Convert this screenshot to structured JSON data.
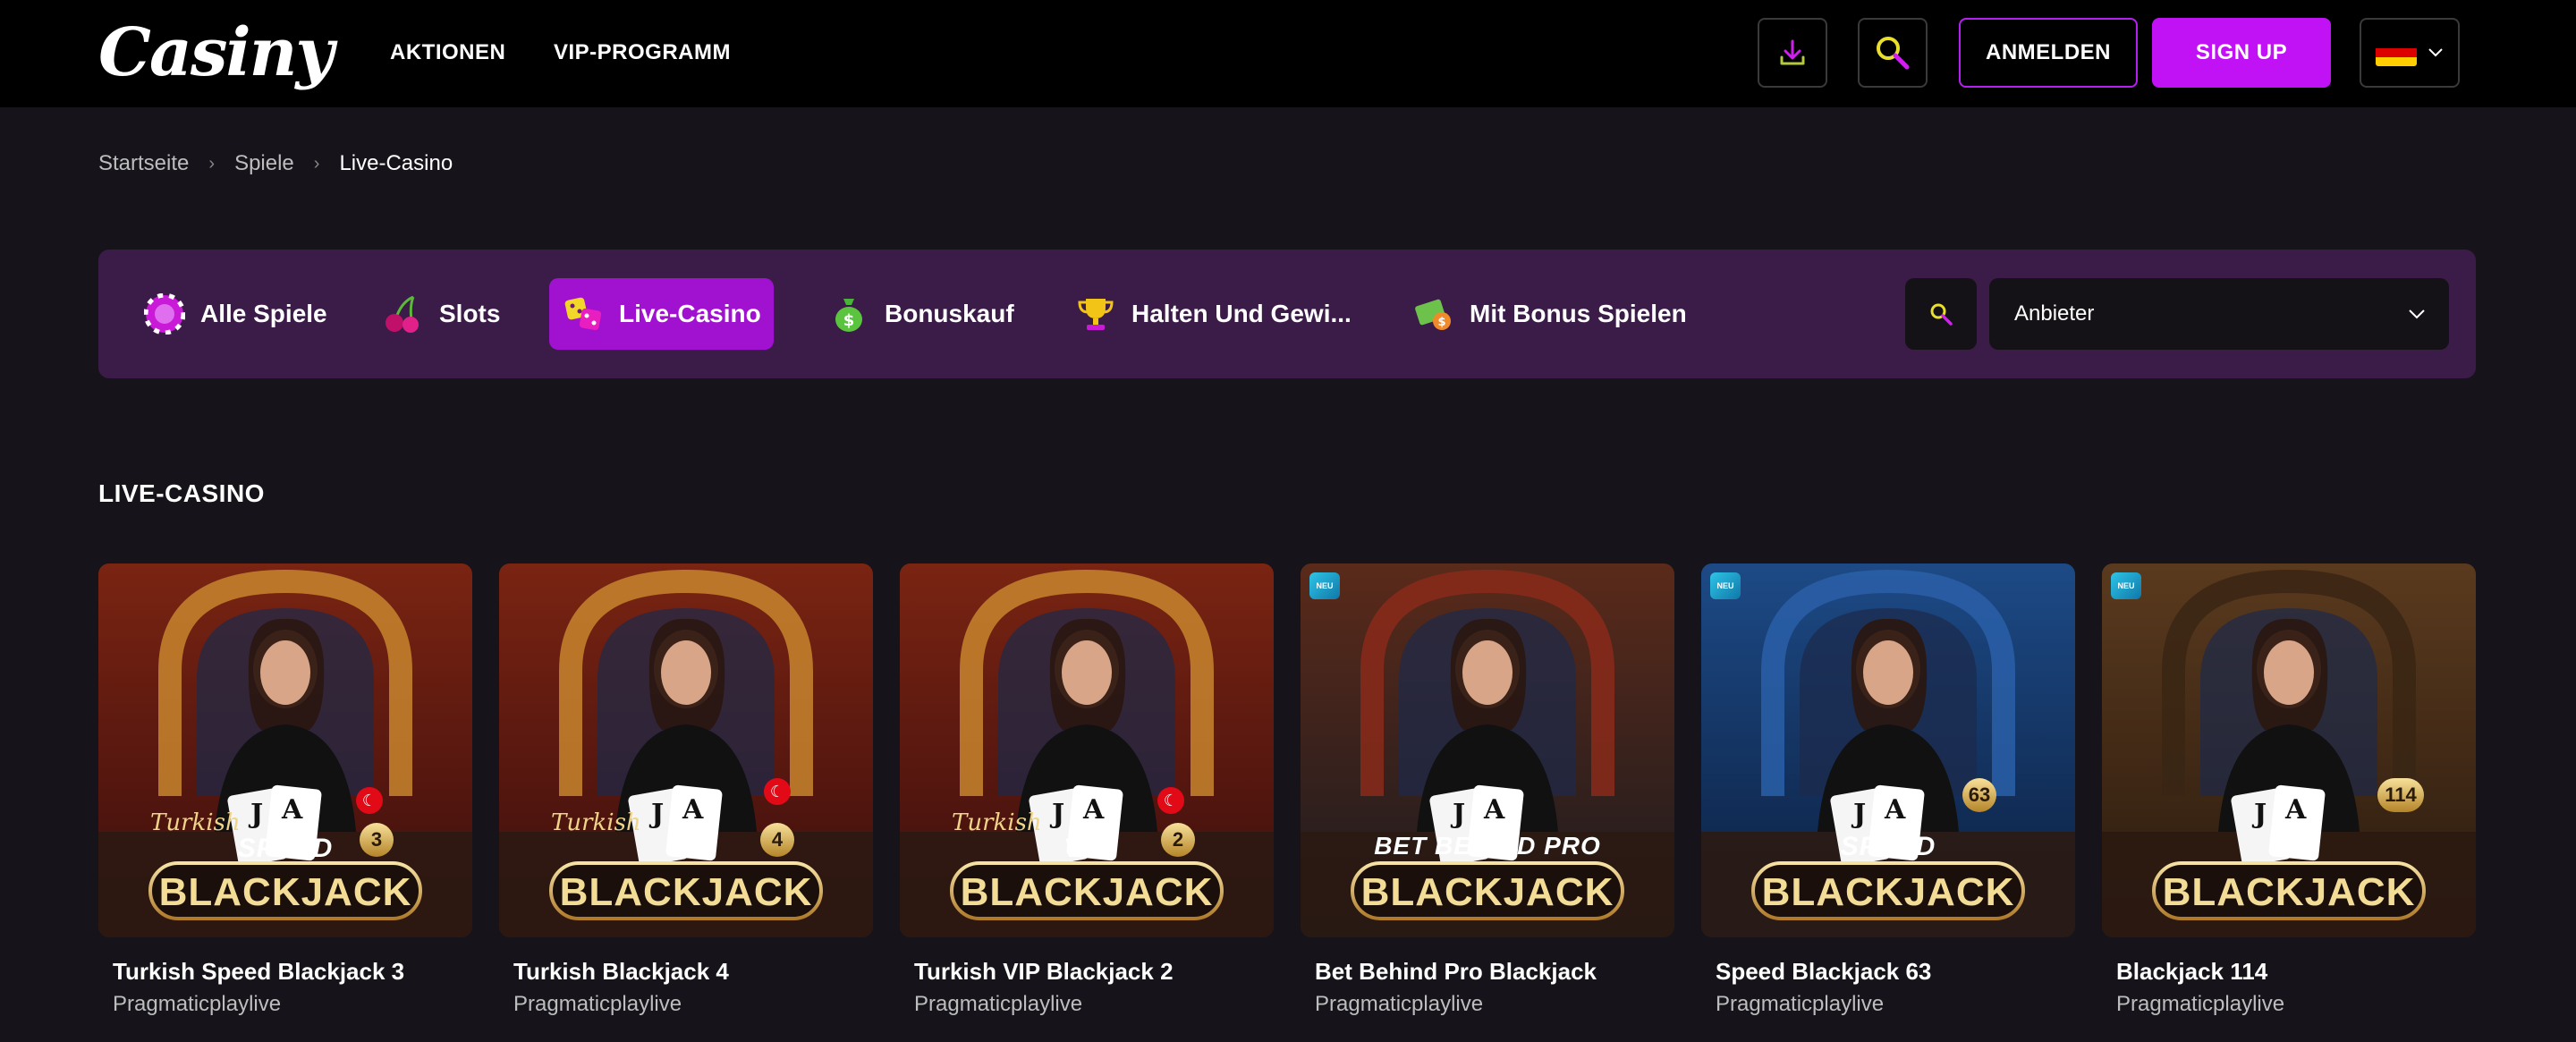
{
  "header": {
    "logo": "Casiny",
    "nav": [
      {
        "label": "AKTIONEN"
      },
      {
        "label": "VIP-PROGRAMM"
      }
    ],
    "login_label": "ANMELDEN",
    "signup_label": "SIGN UP",
    "language_flag": "de-flag-icon"
  },
  "breadcrumb": [
    "Startseite",
    "Spiele",
    "Live-Casino"
  ],
  "categories": [
    {
      "label": "Alle Spiele",
      "icon": "chip-icon",
      "active": false
    },
    {
      "label": "Slots",
      "icon": "cherry-icon",
      "active": false
    },
    {
      "label": "Live-Casino",
      "icon": "dice-icon",
      "active": true
    },
    {
      "label": "Bonuskauf",
      "icon": "money-bag-icon",
      "active": false
    },
    {
      "label": "Halten Und Gewi...",
      "icon": "trophy-icon",
      "active": false
    },
    {
      "label": "Mit Bonus Spielen",
      "icon": "bonus-ticket-icon",
      "active": false
    }
  ],
  "provider_select": {
    "label": "Anbieter"
  },
  "section": {
    "title": "LIVE-CASINO"
  },
  "games": [
    {
      "title": "Turkish Speed Blackjack 3",
      "provider": "Pragmaticplaylive",
      "thumb_text": [
        "Turkish",
        "SPEED",
        "BLACKJACK"
      ],
      "badge_number": "3",
      "is_new": false
    },
    {
      "title": "Turkish Blackjack 4",
      "provider": "Pragmaticplaylive",
      "thumb_text": [
        "Turkish",
        "",
        "BLACKJACK"
      ],
      "badge_number": "4",
      "is_new": false
    },
    {
      "title": "Turkish VIP Blackjack 2",
      "provider": "Pragmaticplaylive",
      "thumb_text": [
        "Turkish",
        "VIP",
        "BLACKJACK"
      ],
      "badge_number": "2",
      "is_new": false
    },
    {
      "title": "Bet Behind Pro Blackjack",
      "provider": "Pragmaticplaylive",
      "thumb_text": [
        "",
        "BET BEHIND PRO",
        "BLACKJACK"
      ],
      "badge_number": "",
      "is_new": true,
      "new_label": "NEU"
    },
    {
      "title": "Speed Blackjack 63",
      "provider": "Pragmaticplaylive",
      "thumb_text": [
        "",
        "SPEED",
        "BLACKJACK"
      ],
      "badge_number": "63",
      "is_new": true,
      "new_label": "NEU"
    },
    {
      "title": "Blackjack 114",
      "provider": "Pragmaticplaylive",
      "thumb_text": [
        "",
        "",
        "BLACKJACK"
      ],
      "badge_number": "114",
      "is_new": true,
      "new_label": "NEU"
    }
  ],
  "colors": {
    "accent": "#c112f5",
    "catbar_bg": "#3b1b48",
    "active_cat": "#a012cf",
    "page_bg": "#16141a"
  }
}
